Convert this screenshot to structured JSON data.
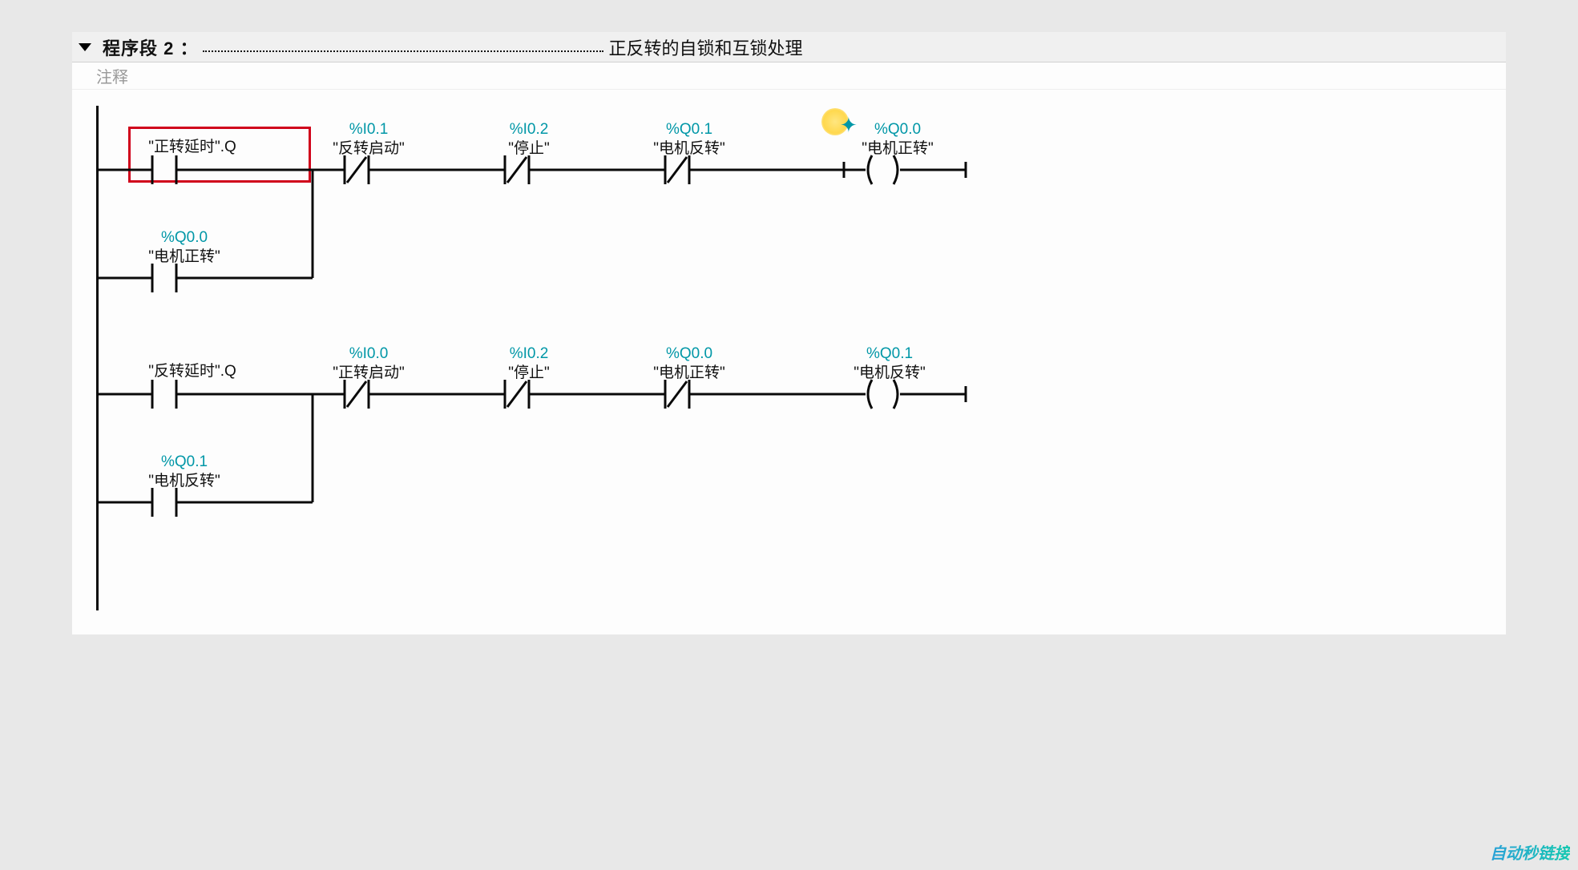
{
  "network": {
    "title": "程序段 2 ：",
    "description": "正反转的自锁和互锁处理",
    "comment_placeholder": "注释"
  },
  "rungs": [
    {
      "main": [
        {
          "kind": "NO",
          "addr": "",
          "name": "\"正转延时\".Q"
        },
        {
          "kind": "NC",
          "addr": "%I0.1",
          "name": "\"反转启动\""
        },
        {
          "kind": "NC",
          "addr": "%I0.2",
          "name": "\"停止\""
        },
        {
          "kind": "NC",
          "addr": "%Q0.1",
          "name": "\"电机反转\""
        },
        {
          "kind": "COIL",
          "addr": "%Q0.0",
          "name": "\"电机正转\""
        }
      ],
      "branch": {
        "kind": "NO",
        "addr": "%Q0.0",
        "name": "\"电机正转\""
      }
    },
    {
      "main": [
        {
          "kind": "NO",
          "addr": "",
          "name": "\"反转延时\".Q"
        },
        {
          "kind": "NC",
          "addr": "%I0.0",
          "name": "\"正转启动\""
        },
        {
          "kind": "NC",
          "addr": "%I0.2",
          "name": "\"停止\""
        },
        {
          "kind": "NC",
          "addr": "%Q0.0",
          "name": "\"电机正转\""
        },
        {
          "kind": "COIL",
          "addr": "%Q0.1",
          "name": "\"电机反转\""
        }
      ],
      "branch": {
        "kind": "NO",
        "addr": "%Q0.1",
        "name": "\"电机反转\""
      }
    }
  ],
  "watermark": "自动秒链接"
}
